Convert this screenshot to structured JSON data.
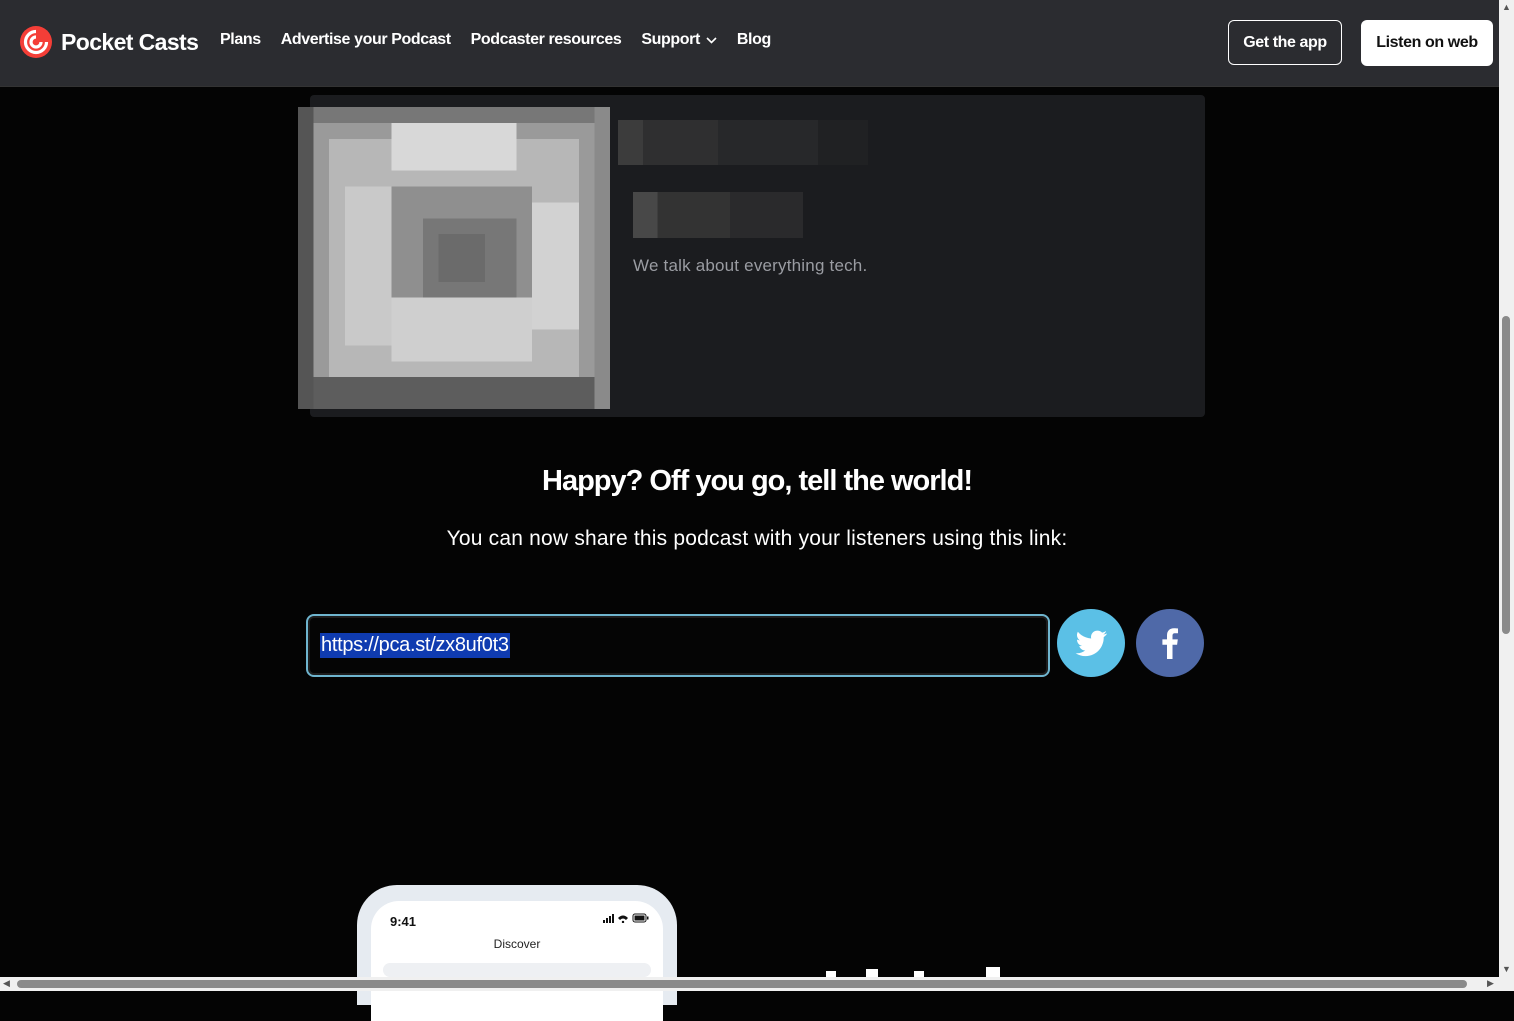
{
  "header": {
    "brand": "Pocket Casts",
    "nav": [
      {
        "label": "Plans"
      },
      {
        "label": "Advertise your Podcast"
      },
      {
        "label": "Podcaster resources"
      },
      {
        "label": "Support"
      },
      {
        "label": "Blog"
      }
    ],
    "get_app": "Get the app",
    "listen_web": "Listen on web"
  },
  "podcast": {
    "description": "We talk about everything tech."
  },
  "share": {
    "title": "Happy? Off you go, tell the world!",
    "subtitle": "You can now share this podcast with your listeners using this link:",
    "link": "https://pca.st/zx8uf0t3"
  },
  "phone": {
    "time": "9:41",
    "screen_title": "Discover"
  },
  "colors": {
    "brand_red": "#f43e37",
    "twitter": "#5bc0e6",
    "facebook": "#4f69a8",
    "selection": "#0f3bb0"
  }
}
